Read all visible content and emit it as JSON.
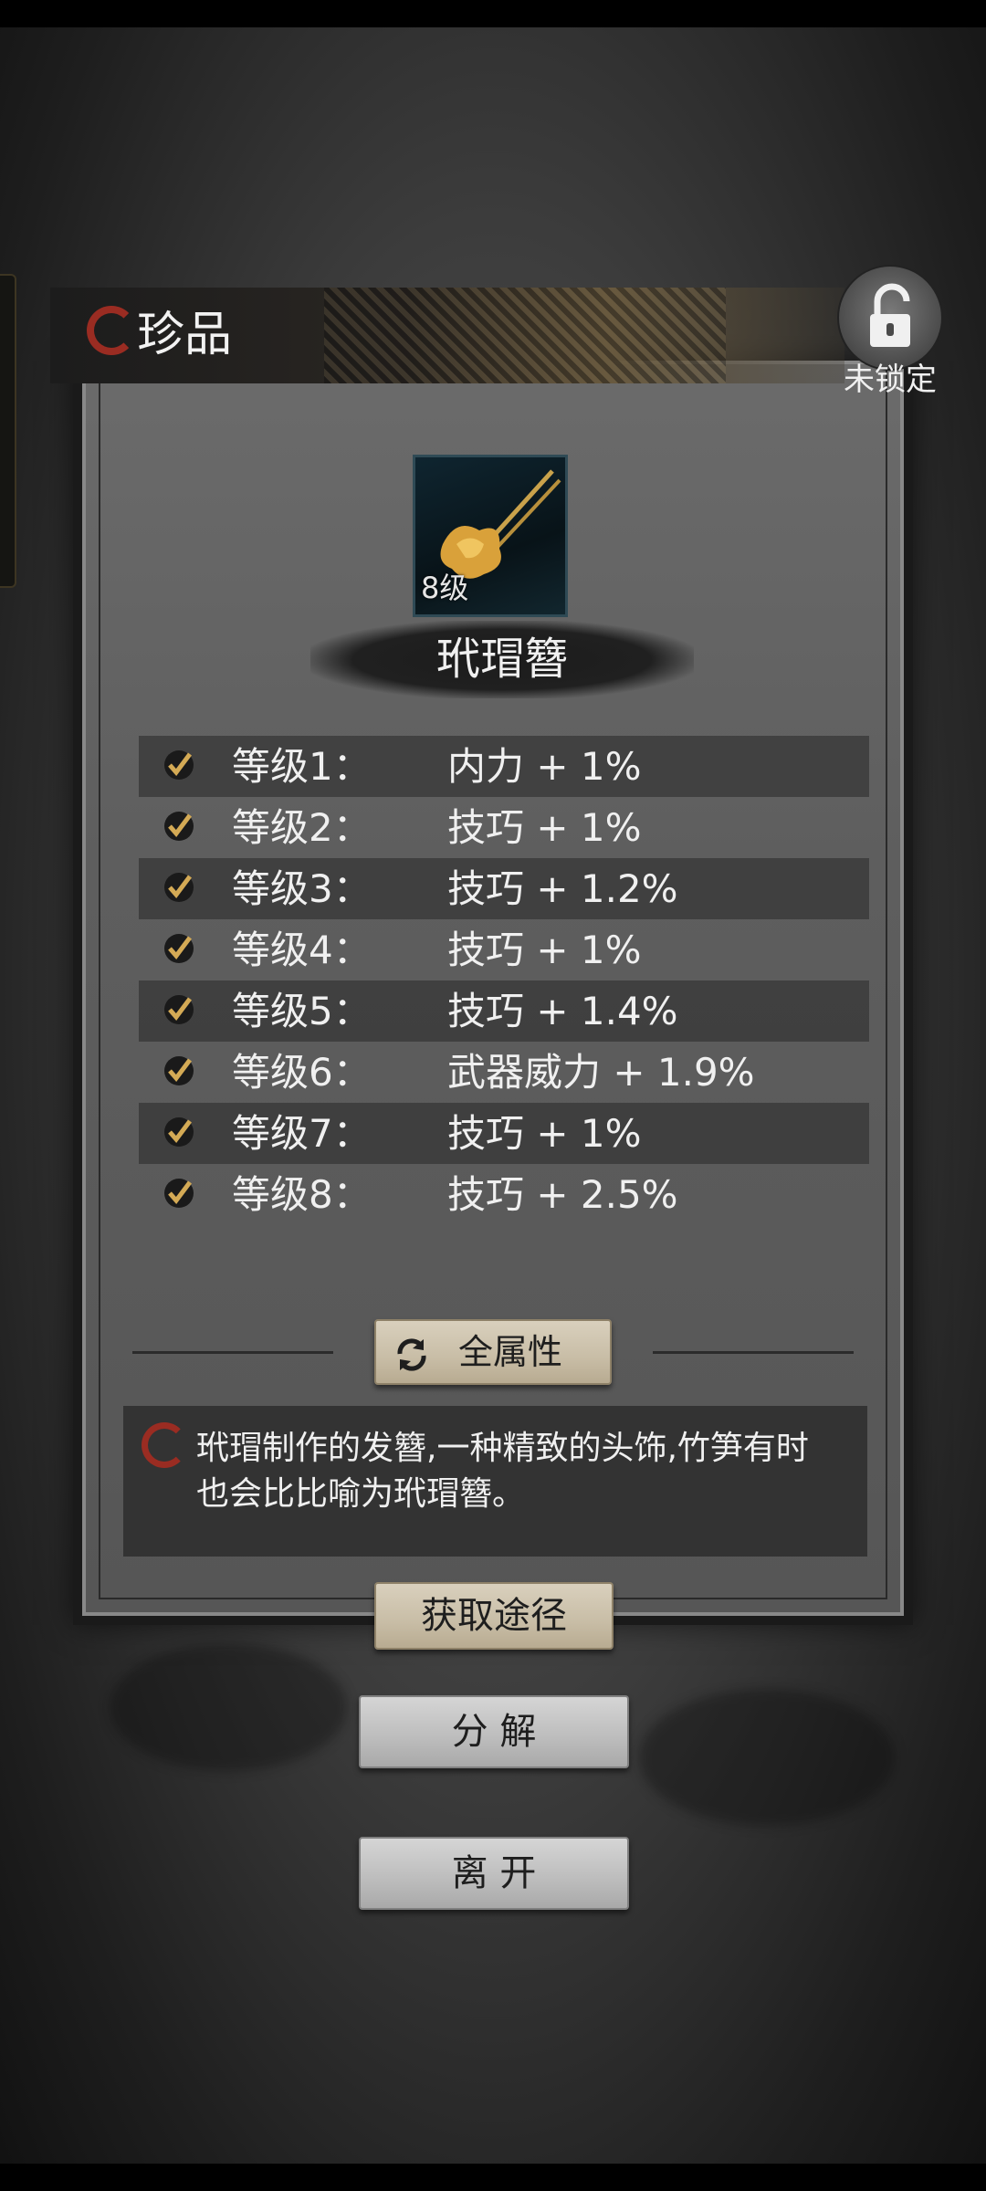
{
  "header": {
    "title": "珍品"
  },
  "lock": {
    "label": "未锁定",
    "icon": "unlock-icon"
  },
  "item": {
    "level": "8级",
    "name": "玳瑁簪",
    "icon": "hairpin-icon"
  },
  "attributes": [
    {
      "level": "等级1：",
      "bonus": "内力 + 1%"
    },
    {
      "level": "等级2：",
      "bonus": "技巧 + 1%"
    },
    {
      "level": "等级3：",
      "bonus": "技巧 + 1.2%"
    },
    {
      "level": "等级4：",
      "bonus": "技巧 + 1%"
    },
    {
      "level": "等级5：",
      "bonus": "技巧 + 1.4%"
    },
    {
      "level": "等级6：",
      "bonus": "武器威力 + 1.9%"
    },
    {
      "level": "等级7：",
      "bonus": "技巧 + 1%"
    },
    {
      "level": "等级8：",
      "bonus": "技巧 + 2.5%"
    }
  ],
  "all_attributes_button": {
    "label": "全属性",
    "icon": "refresh-icon"
  },
  "description": "玳瑁制作的发簪,一种精致的头饰,竹笋有时也会比比喻为玳瑁簪。",
  "buttons": {
    "obtain": "获取途径",
    "decompose": "分 解",
    "leave": "离 开"
  },
  "colors": {
    "accent_red": "#9a2c22",
    "gold": "#c9a24b",
    "button_beige": "#d1c6b0"
  }
}
